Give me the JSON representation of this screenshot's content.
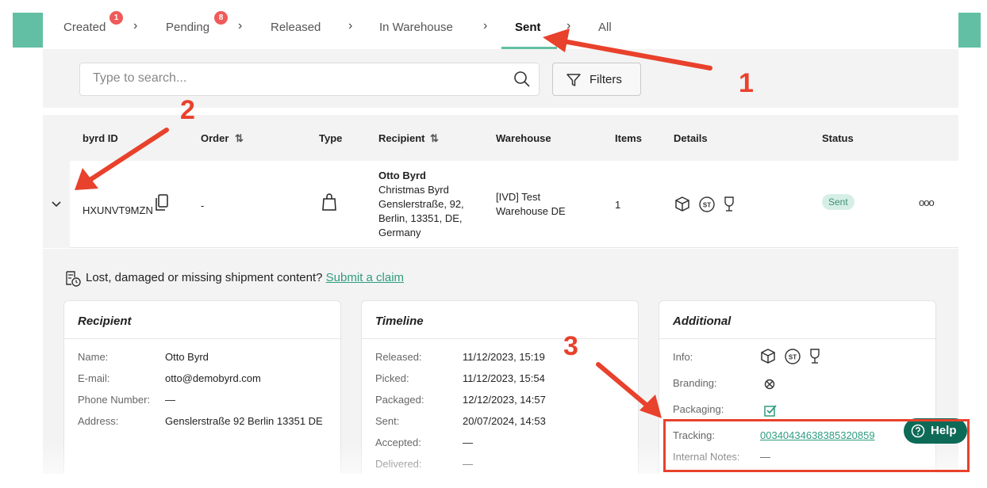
{
  "tabs": [
    {
      "label": "Created",
      "badge": "1"
    },
    {
      "label": "Pending",
      "badge": "8"
    },
    {
      "label": "Released",
      "badge": null
    },
    {
      "label": "In Warehouse",
      "badge": null
    },
    {
      "label": "Sent",
      "badge": null
    },
    {
      "label": "All",
      "badge": null
    }
  ],
  "search": {
    "placeholder": "Type to search..."
  },
  "filters_label": "Filters",
  "table": {
    "headers": [
      "byrd ID",
      "Order",
      "Type",
      "Recipient",
      "Warehouse",
      "Items",
      "Details",
      "Status"
    ],
    "row": {
      "byrd_id": "HXUNVT9MZN",
      "order": "-",
      "recipient_name": "Otto Byrd",
      "recipient_lines": [
        "Christmas Byrd",
        "Genslerstraße, 92,",
        "Berlin, 13351, DE,",
        "Germany"
      ],
      "warehouse_lines": [
        "[IVD] Test",
        "Warehouse DE"
      ],
      "items": "1",
      "status": "Sent"
    }
  },
  "claim": {
    "text": "Lost, damaged or missing shipment content?",
    "link": "Submit a claim"
  },
  "recipient_card": {
    "title": "Recipient",
    "rows": [
      {
        "k": "Name:",
        "v": "Otto Byrd"
      },
      {
        "k": "E-mail:",
        "v": "otto@demobyrd.com"
      },
      {
        "k": "Phone Number:",
        "v": "—"
      },
      {
        "k": "Address:",
        "v": "Genslerstraße 92 Berlin 13351 DE"
      }
    ]
  },
  "timeline_card": {
    "title": "Timeline",
    "rows": [
      {
        "k": "Released:",
        "v": "11/12/2023, 15:19"
      },
      {
        "k": "Picked:",
        "v": "11/12/2023, 15:54"
      },
      {
        "k": "Packaged:",
        "v": "12/12/2023, 14:57"
      },
      {
        "k": "Sent:",
        "v": "20/07/2024, 14:53"
      },
      {
        "k": "Accepted:",
        "v": "—"
      },
      {
        "k": "Delivered:",
        "v": "—"
      }
    ]
  },
  "additional_card": {
    "title": "Additional",
    "info_label": "Info:",
    "branding_label": "Branding:",
    "packaging_label": "Packaging:",
    "tracking_label": "Tracking:",
    "tracking_value": "00340434638385320859",
    "notes_label": "Internal Notes:",
    "notes_value": "—"
  },
  "help_label": "Help",
  "annotations": {
    "n1": "1",
    "n2": "2",
    "n3": "3",
    "color": "#e8412c"
  },
  "colors": {
    "accent": "#62bfa3",
    "link": "#2f9c7e",
    "badge": "#f05a5a",
    "help": "#0d6a57"
  }
}
